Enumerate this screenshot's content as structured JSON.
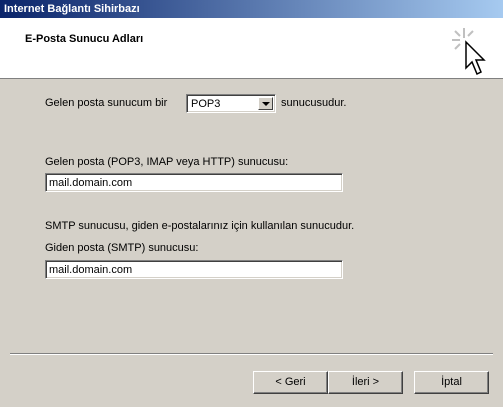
{
  "window": {
    "title": "Internet Bağlantı Sihirbazı"
  },
  "header": {
    "title": "E-Posta Sunucu Adları"
  },
  "server_type": {
    "prefix_label": "Gelen posta sunucum bir",
    "selected": "POP3",
    "suffix_label": "sunucusudur."
  },
  "incoming": {
    "label": "Gelen posta (POP3, IMAP veya HTTP) sunucusu:",
    "value": "mail.domain.com"
  },
  "smtp": {
    "description": "SMTP sunucusu, giden e-postalarınız için kullanılan sunucudur.",
    "label": "Giden posta (SMTP) sunucusu:",
    "value": "mail.domain.com"
  },
  "buttons": {
    "back": "< Geri",
    "next": "İleri >",
    "cancel": "İptal"
  }
}
